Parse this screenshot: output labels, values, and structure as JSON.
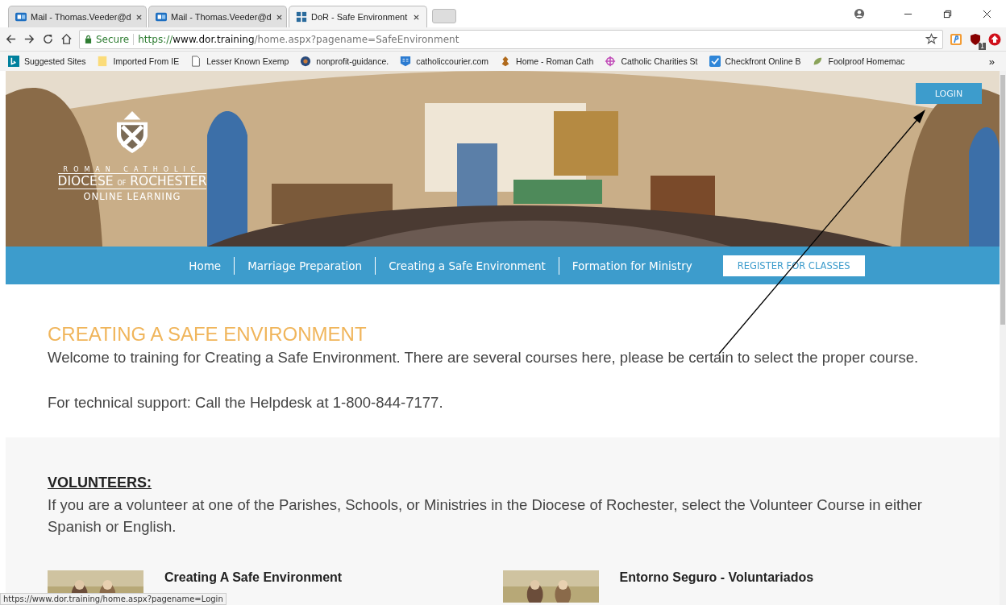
{
  "browser": {
    "tabs": [
      {
        "title": "Mail - Thomas.Veeder@d",
        "kind": "mail",
        "selected": false
      },
      {
        "title": "Mail - Thomas.Veeder@d",
        "kind": "mail",
        "selected": false
      },
      {
        "title": "DoR - Safe Environment",
        "kind": "site",
        "selected": true
      }
    ],
    "secure_label": "Secure",
    "url_scheme": "https://",
    "url_host": "www.dor.training",
    "url_path": "/home.aspx?pagename=SafeEnvironment",
    "extension_badge": "1",
    "bookmarks": [
      {
        "title": "Suggested Sites",
        "kind": "bing"
      },
      {
        "title": "Imported From IE",
        "kind": "folder"
      },
      {
        "title": "Lesser Known Exemp",
        "kind": "page"
      },
      {
        "title": "nonprofit-guidance.",
        "kind": "globe"
      },
      {
        "title": "catholiccourier.com",
        "kind": "shield"
      },
      {
        "title": "Home - Roman Cath",
        "kind": "crest"
      },
      {
        "title": "Catholic Charities St",
        "kind": "target"
      },
      {
        "title": "Checkfront Online B",
        "kind": "check"
      },
      {
        "title": "Foolproof Homemac",
        "kind": "leaf"
      }
    ],
    "bookmarks_overflow": "»"
  },
  "page": {
    "logo": {
      "top_line": "ROMAN CATHOLIC",
      "name_left": "DIOCESE",
      "name_of": "OF",
      "name_right": "ROCHESTER",
      "bottom_line": "ONLINE LEARNING"
    },
    "login_button": "LOGIN",
    "nav": [
      "Home",
      "Marriage Preparation",
      "Creating a Safe Environment",
      "Formation for Ministry"
    ],
    "register_button": "REGISTER FOR CLASSES",
    "heading": "CREATING A SAFE ENVIRONMENT",
    "intro": "Welcome to training for Creating a Safe Environment. There are several courses here, please be certain to select the proper course.",
    "support": "For technical support: Call the Helpdesk at 1-800-844-7177.",
    "volunteers_heading": "VOLUNTEERS:",
    "volunteers_text": "If you are a volunteer at one of the Parishes, Schools, or Ministries in the Diocese of Rochester, select the Volunteer Course in either Spanish or English.",
    "courses": [
      {
        "title": "Creating A Safe Environment"
      },
      {
        "title": "Entorno Seguro - Voluntariados"
      }
    ]
  },
  "status_url": "https://www.dor.training/home.aspx?pagename=Login"
}
